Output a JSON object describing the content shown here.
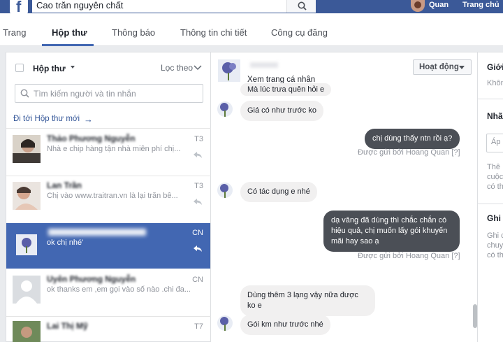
{
  "topbar": {
    "search_value": "Cao trăn nguyên chất",
    "user_name": "Quan",
    "home_label": "Trang chủ"
  },
  "tabs": [
    {
      "label": "Trang"
    },
    {
      "label": "Hộp thư"
    },
    {
      "label": "Thông báo"
    },
    {
      "label": "Thông tin chi tiết"
    },
    {
      "label": "Công cụ đăng"
    }
  ],
  "inbox": {
    "label": "Hộp thư",
    "filter_label": "Lọc theo",
    "search_placeholder": "Tìm kiếm người và tin nhắn",
    "goto_new": "Đi tới Hộp thư mới",
    "threads": [
      {
        "name": "Thảo Phương Nguyễn",
        "snippet": "Nhà e chip hàng tận nhà miễn phí chị...",
        "when": "T3"
      },
      {
        "name": "Lan Trần",
        "snippet": "Chị vào www.traitran.vn là lại trăn bê...",
        "when": "T3"
      },
      {
        "name": "",
        "snippet": "ok chị nhé'",
        "when": "CN"
      },
      {
        "name": "Uyên Phương Nguyễn",
        "snippet": "ok thanks em ,em gọi vào số nào .chi đa...",
        "when": "CN"
      },
      {
        "name": "Lai Thị Mỹ",
        "snippet": "",
        "when": "T7"
      }
    ]
  },
  "conversation": {
    "profile_link": "Xem trang cá nhân",
    "status_button": "Hoạt động",
    "messages": [
      {
        "type": "in",
        "text": "Mà lúc trưa quên hỏi e"
      },
      {
        "type": "in",
        "text": "Giá có như trước ko"
      },
      {
        "type": "out",
        "text": "chị dùng thấy ntn rồi ạ?"
      },
      {
        "type": "sent",
        "text": "Được gửi bởi Hoang Quan [?]"
      },
      {
        "type": "in",
        "text": "Có tác dụng e nhé"
      },
      {
        "type": "out",
        "text": "dạ vâng đã dùng thì chắc chắn có hiệu quả, chị muốn lấy gói khuyến mãi hay sao ạ"
      },
      {
        "type": "sent",
        "text": "Được gửi bởi Hoang Quan [?]"
      },
      {
        "type": "in",
        "text": "Dùng thêm 3 lạng vậy nữa được ko e"
      },
      {
        "type": "in",
        "text": "Gói km như trước nhé"
      }
    ]
  },
  "right_panel": {
    "t1": "Giới",
    "t2": "Khôn",
    "t3": "Nhãn",
    "t4": "Áp",
    "t5": "Thê",
    "t6": "cuộc",
    "t7": "có th",
    "t8": "Ghi c",
    "t9": "Ghi c",
    "t10": "chuy",
    "t11": "có th"
  }
}
